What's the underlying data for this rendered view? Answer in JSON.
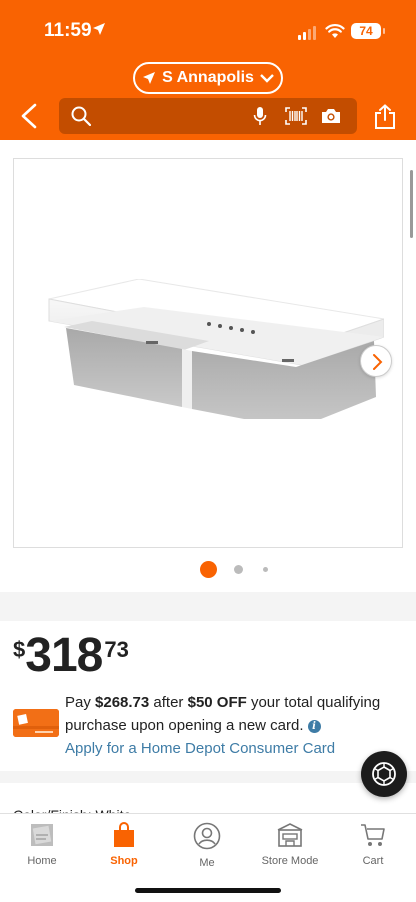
{
  "status_bar": {
    "time": "11:59",
    "battery": "74"
  },
  "header": {
    "store_name": "S Annapolis",
    "search_placeholder": ""
  },
  "carousel": {
    "total_slides": 3,
    "active_slide": 1
  },
  "price": {
    "currency": "$",
    "dollars": "318",
    "cents": "73"
  },
  "promo": {
    "pay_prefix": "Pay ",
    "pay_amount": "$268.73",
    "after_text": " after ",
    "discount": "$50 OFF",
    "rest_text": " your total qualifying purchase upon opening a new card.",
    "apply_link": "Apply for a Home Depot Consumer Card"
  },
  "next_section": {
    "label_partial": "Color/Finish: White"
  },
  "tabbar": {
    "items": [
      {
        "label": "Home",
        "icon": "home-depot-logo-icon"
      },
      {
        "label": "Shop",
        "icon": "shop-bag-icon"
      },
      {
        "label": "Me",
        "icon": "user-icon"
      },
      {
        "label": "Store Mode",
        "icon": "store-icon"
      },
      {
        "label": "Cart",
        "icon": "cart-icon"
      }
    ],
    "active": "Shop"
  },
  "colors": {
    "brand": "#f96302",
    "link": "#3e7ca6"
  }
}
